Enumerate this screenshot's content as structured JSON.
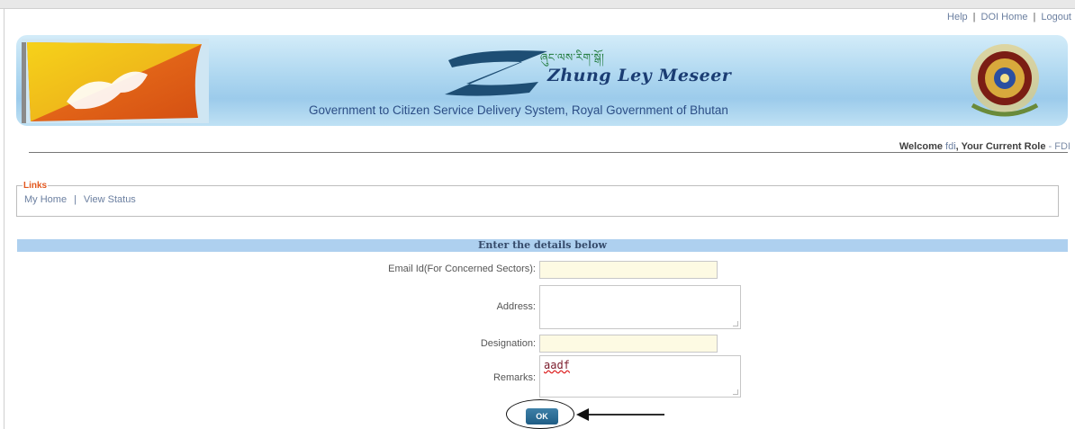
{
  "top_links": {
    "help": "Help",
    "doi_home": "DOI Home",
    "logout": "Logout"
  },
  "banner": {
    "tibetan_title": "ཞུང་ལས་རིག་སྒོ།",
    "script_title": "Zhung Ley Meseer",
    "tagline": "Government to Citizen Service Delivery System, Royal Government of Bhutan"
  },
  "welcome": {
    "prefix": "Welcome",
    "user": "fdi",
    "role_label": ", Your Current Role",
    "role": "- FDI"
  },
  "links_panel": {
    "legend": "Links",
    "items": [
      "My Home",
      "View Status"
    ]
  },
  "form": {
    "heading": "Enter the details below",
    "email_label": "Email Id(For Concerned Sectors):",
    "email_value": "",
    "address_label": "Address:",
    "address_value": "",
    "designation_label": "Designation:",
    "designation_value": "",
    "remarks_label": "Remarks:",
    "remarks_value": "aadf",
    "ok_label": "OK"
  },
  "colors": {
    "link": "#6b7fa0",
    "header_band": "#aed0ef",
    "legend": "#e2581f",
    "button": "#1f5d85",
    "input_bg": "#fdfae3"
  }
}
